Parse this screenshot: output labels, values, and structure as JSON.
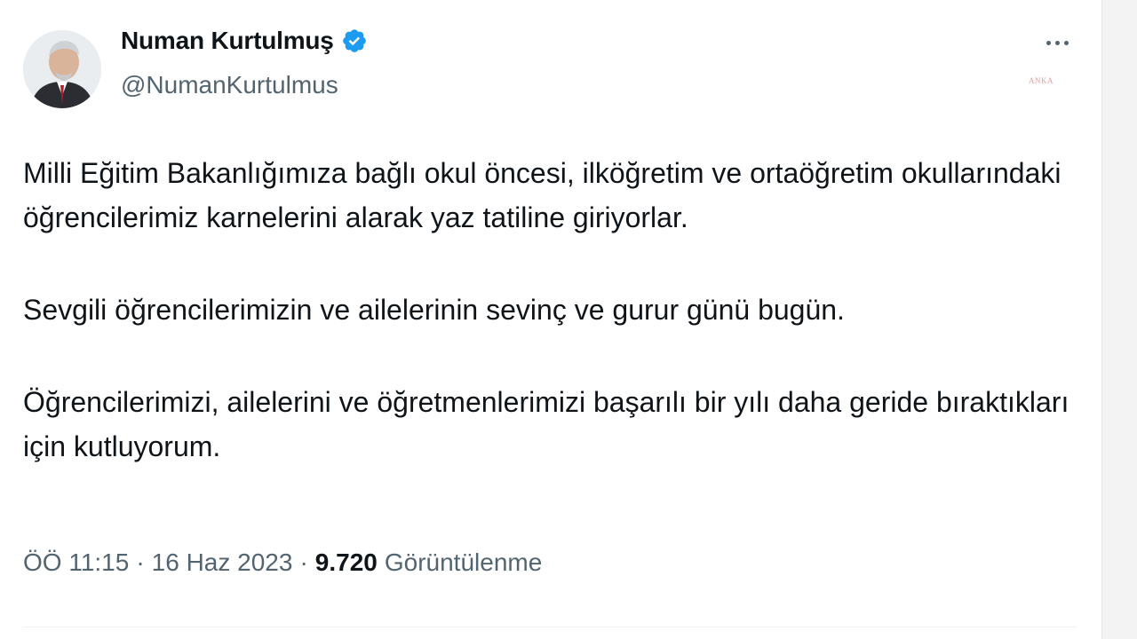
{
  "tweet": {
    "author": {
      "display_name": "Numan Kurtulmuş",
      "handle": "@NumanKurtulmus",
      "verified": true,
      "verified_color": "#1d9bf0"
    },
    "watermark": "ANKA",
    "paragraphs": [
      "Milli Eğitim Bakanlığımıza bağlı okul öncesi, ilköğretim ve ortaöğretim okullarındaki öğrencilerimiz karnelerini alarak yaz tatiline giriyorlar.",
      "Sevgili öğrencilerimizin ve ailelerinin sevinç ve gurur günü bugün.",
      "Öğrencilerimizi, ailelerini ve öğretmenlerimizi başarılı bir yılı daha geride bıraktıkları için kutluyorum."
    ],
    "meta": {
      "time": "ÖÖ 11:15",
      "separator": "·",
      "date": "16 Haz 2023",
      "views_count": "9.720",
      "views_label": "Görüntülenme"
    },
    "icons": {
      "more": "more-horizontal-icon",
      "verified": "verified-badge-icon"
    }
  }
}
